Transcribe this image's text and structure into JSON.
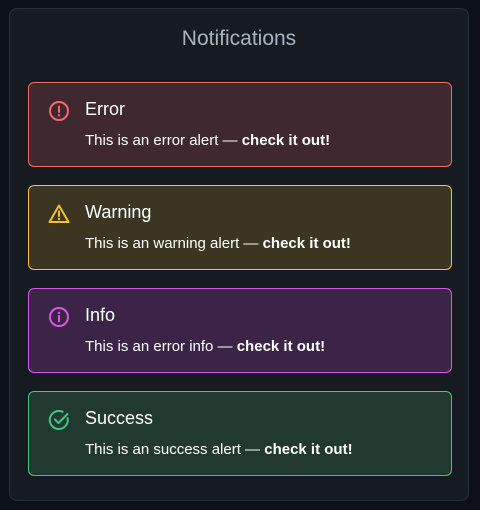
{
  "panel": {
    "title": "Notifications"
  },
  "alerts": [
    {
      "type": "error",
      "icon": "error-circle-icon",
      "color": "#f26b6b",
      "background": "#3f282f",
      "heading": "Error",
      "message": "This is an error alert —",
      "emphasis": "check it out!"
    },
    {
      "type": "warning",
      "icon": "warning-triangle-icon",
      "color": "#f2c230",
      "background": "#3b3522",
      "heading": "Warning",
      "message": "This is an warning alert —",
      "emphasis": "check it out!"
    },
    {
      "type": "info",
      "icon": "info-circle-icon",
      "color": "#d957e8",
      "background": "#3b2446",
      "heading": "Info",
      "message": "This is an error info —",
      "emphasis": "check it out!"
    },
    {
      "type": "success",
      "icon": "check-circle-icon",
      "color": "#40c786",
      "background": "#21392f",
      "heading": "Success",
      "message": "This is an success alert —",
      "emphasis": "check it out!"
    }
  ]
}
